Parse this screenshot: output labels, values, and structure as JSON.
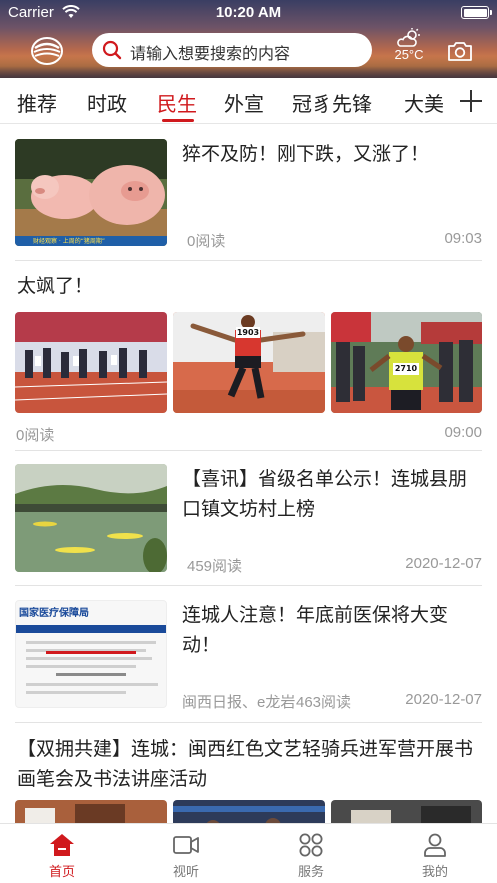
{
  "status_bar": {
    "carrier": "Carrier",
    "time": "10:20 AM"
  },
  "header": {
    "search_placeholder": "请输入想要搜索的内容",
    "temperature": "25°C"
  },
  "tabs": [
    {
      "label": "推荐"
    },
    {
      "label": "时政"
    },
    {
      "label": "民生",
      "active": true
    },
    {
      "label": "外宣"
    },
    {
      "label": "冠豸先锋"
    },
    {
      "label": "大美"
    }
  ],
  "feed": {
    "item1": {
      "title": "猝不及防！刚下跌，又涨了！",
      "reads": "0阅读",
      "time": "09:03",
      "thumb_caption": "财经观察 · 上周的“猪周期”"
    },
    "item2": {
      "title": "太飒了！",
      "reads": "0阅读",
      "time": "09:00",
      "bibs": [
        "1903",
        "2710"
      ]
    },
    "item3": {
      "title": "【喜讯】省级名单公示！连城县朋口镇文坊村上榜",
      "reads": "459阅读",
      "time": "2020-12-07"
    },
    "item4": {
      "title": "连城人注意！年底前医保将大变动！",
      "source": "闽西日报、e龙岩",
      "reads": "463阅读",
      "time": "2020-12-07",
      "thumb_header": "国家医疗保障局"
    },
    "item5": {
      "title": "【双拥共建】连城：闽西红色文艺轻骑兵进军营开展书画笔会及书法讲座活动"
    }
  },
  "bottom_nav": [
    {
      "label": "首页",
      "icon": "home-icon",
      "active": true
    },
    {
      "label": "视听",
      "icon": "video-icon"
    },
    {
      "label": "服务",
      "icon": "services-icon"
    },
    {
      "label": "我的",
      "icon": "profile-icon"
    }
  ],
  "colors": {
    "accent": "#d0191d"
  }
}
